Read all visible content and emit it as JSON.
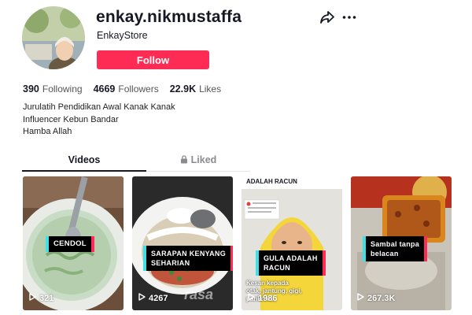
{
  "profile": {
    "username": "enkay.nikmustaffa",
    "nickname": "EnkayStore",
    "follow_label": "Follow",
    "accent": "#fe2c55"
  },
  "stats": [
    {
      "value": "390",
      "label": "Following"
    },
    {
      "value": "4669",
      "label": "Followers"
    },
    {
      "value": "22.9K",
      "label": "Likes"
    }
  ],
  "bio": [
    "Jurulatih Pendidikan Awal Kanak Kanak",
    "Influencer Kebun Bandar",
    "Hamba Allah"
  ],
  "tabs": {
    "videos": "Videos",
    "liked": "Liked"
  },
  "videos": [
    {
      "caption": "CENDOL",
      "views": "321"
    },
    {
      "caption_line1": "SARAPAN KENYANG",
      "caption_line2": "SEHARIAN",
      "views": "4267",
      "watermark": "rasa"
    },
    {
      "header": "ADALAH RACUN",
      "caption_line1": "GULA ADALAH",
      "caption_line2": "RACUN",
      "views": "1986",
      "overlay": "Kesan kepada otak, jantung, gigi, pankreas,"
    },
    {
      "caption_line1": "Sambal tanpa",
      "caption_line2": "belacan",
      "views": "267.3K"
    }
  ],
  "icons": {
    "share": "share-icon",
    "more": "more-icon",
    "lock": "lock-icon",
    "play": "play-icon"
  }
}
